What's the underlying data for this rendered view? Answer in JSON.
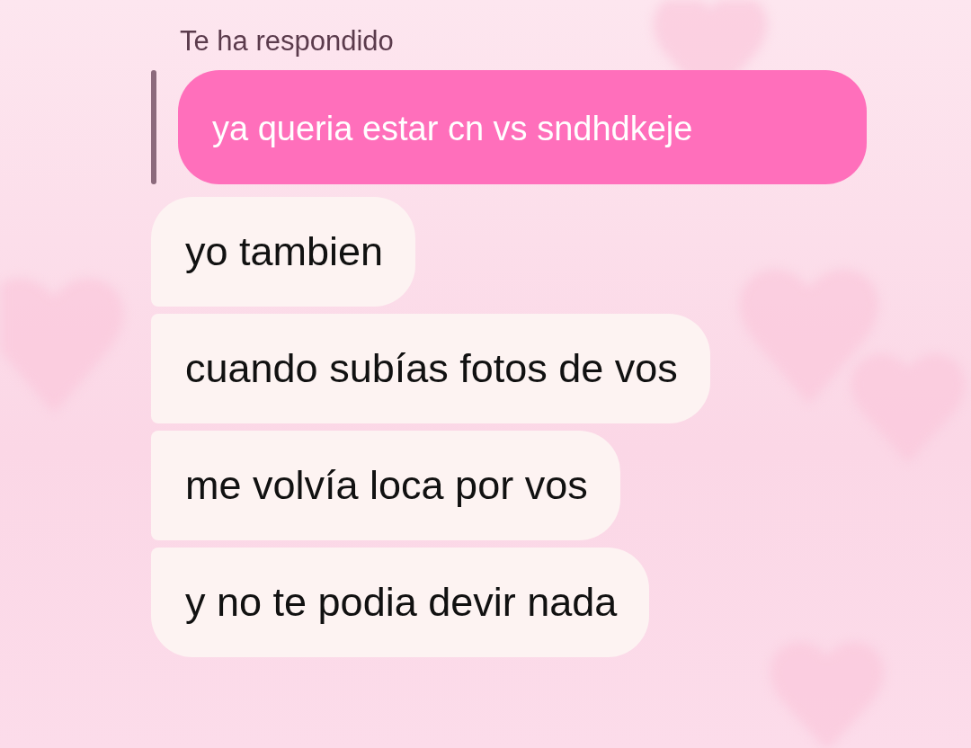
{
  "reply_label": "Te ha respondido",
  "quoted_message": {
    "text": "ya queria estar cn vs sndhdkeje"
  },
  "messages": [
    {
      "text": "yo tambien"
    },
    {
      "text": "cuando subías fotos de vos"
    },
    {
      "text": "me volvía loca por vos"
    },
    {
      "text": "y no te podia devir nada"
    }
  ]
}
